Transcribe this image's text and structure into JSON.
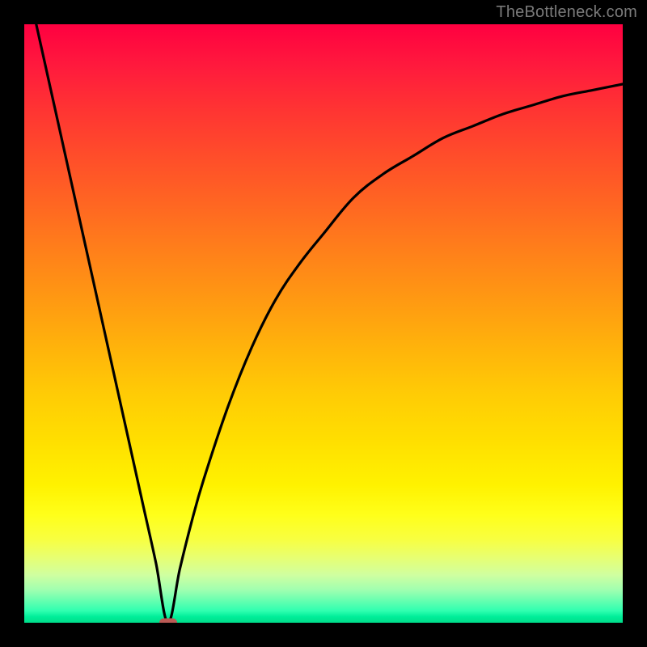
{
  "watermark": "TheBottleneck.com",
  "chart_data": {
    "type": "line",
    "title": "",
    "xlabel": "",
    "ylabel": "",
    "xlim": [
      0,
      100
    ],
    "ylim": [
      0,
      100
    ],
    "grid": false,
    "legend": false,
    "background_gradient": {
      "direction": "vertical",
      "stops": [
        {
          "pos": 0.0,
          "color": "#ff0040"
        },
        {
          "pos": 0.25,
          "color": "#ff6622"
        },
        {
          "pos": 0.5,
          "color": "#ffb30b"
        },
        {
          "pos": 0.75,
          "color": "#ffff1a"
        },
        {
          "pos": 0.95,
          "color": "#60ffb0"
        },
        {
          "pos": 1.0,
          "color": "#00dd8a"
        }
      ]
    },
    "minimum_point": {
      "x": 24,
      "y": 0
    },
    "series": [
      {
        "name": "bottleneck-curve",
        "color": "#000000",
        "x": [
          2,
          4,
          6,
          8,
          10,
          12,
          14,
          16,
          18,
          20,
          22,
          24,
          26,
          28,
          30,
          34,
          38,
          42,
          46,
          50,
          55,
          60,
          65,
          70,
          75,
          80,
          85,
          90,
          95,
          100
        ],
        "y": [
          100,
          91,
          82,
          73,
          64,
          55,
          46,
          37,
          28,
          19,
          10,
          0,
          9,
          17,
          24,
          36,
          46,
          54,
          60,
          65,
          71,
          75,
          78,
          81,
          83,
          85,
          86.5,
          88,
          89,
          90
        ]
      }
    ]
  },
  "plot_geometry": {
    "outer_w": 800,
    "outer_h": 800,
    "inner_left": 30,
    "inner_top": 30,
    "inner_w": 740,
    "inner_h": 740
  }
}
